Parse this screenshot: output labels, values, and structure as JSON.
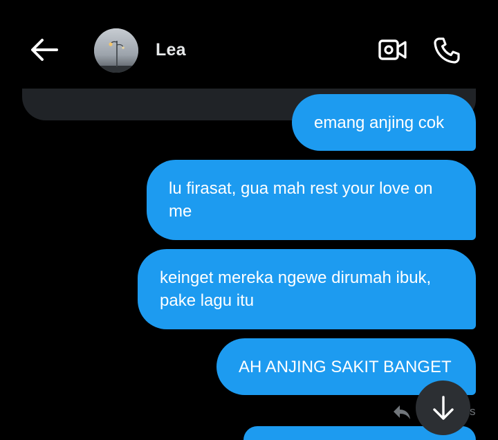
{
  "header": {
    "contact_name": "Lea",
    "icons": {
      "back": "arrow-left-icon",
      "video": "video-call-icon",
      "call": "phone-icon"
    }
  },
  "messages": [
    {
      "text": "emang anjing cok"
    },
    {
      "text": "lu firasat, gua mah rest your love on me"
    },
    {
      "text": "keinget mereka ngewe dirumah ibuk, pake lagu itu"
    },
    {
      "text": "AH ANJING SAKIT BANGET"
    }
  ],
  "meta": {
    "trailing_text": "s"
  },
  "colors": {
    "background": "#000000",
    "bubble_sent": "#1d9bf0",
    "bubble_received": "#202327",
    "muted": "#71767b",
    "fab": "#2c2f33"
  }
}
